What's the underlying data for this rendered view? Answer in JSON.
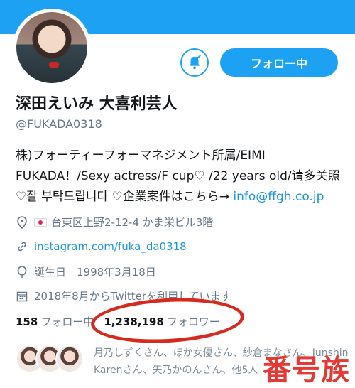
{
  "profile": {
    "display_name": "深田えいみ 大喜利芸人",
    "handle": "@FUKADA0318",
    "bio_text": "株)フォーティーフォーマネジメント所属/EIMI FUKADA！/Sexy actress/F cup♡ /22 years old/请多关照♡잘 부탁드립니다 ♡企業案件はこちら→ ",
    "bio_email": "info@ffgh.co.jp",
    "location": "台東区上野2-12-4 かま栄ビル3階",
    "website": "instagram.com/fuka_da0318",
    "birthday": "誕生日　1998年3月18日",
    "joined": "2018年8月からTwitterを利用しています"
  },
  "actions": {
    "follow_label": "フォロー中"
  },
  "stats": {
    "following_count": "158",
    "following_label": "フォロー中",
    "followers_count": "1,238,198",
    "followers_label": "フォロワー"
  },
  "followed_by": {
    "text": "月乃しずくさん、ほか女優さん、紗倉まなさん、Junshin Karenさん、矢乃かのんさん、他5人"
  },
  "watermark": "番号族",
  "colors": {
    "accent": "#1da1f2",
    "annotation": "#d62a1e",
    "watermark": "#e53935"
  },
  "icons": [
    "bell-check-icon",
    "location-pin-icon",
    "link-icon",
    "balloon-icon",
    "calendar-icon"
  ]
}
